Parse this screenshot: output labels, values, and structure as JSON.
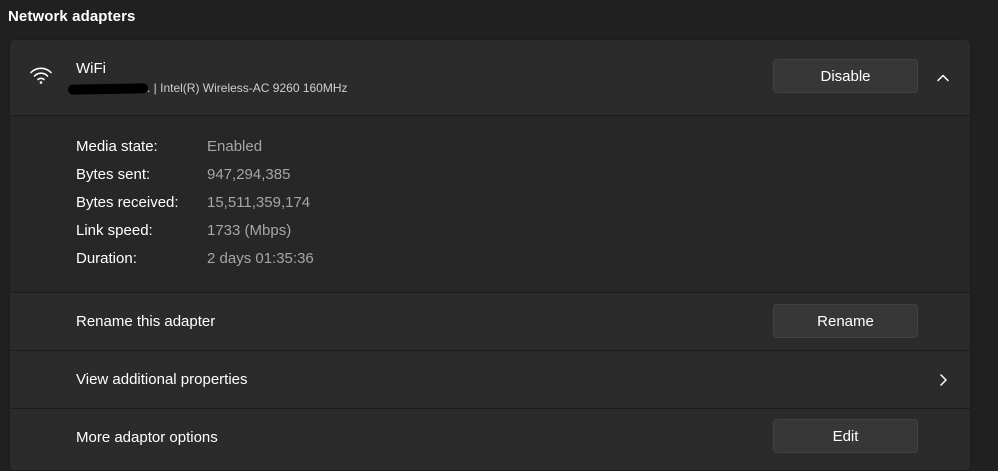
{
  "section": {
    "title": "Network adapters"
  },
  "adapter": {
    "name": "WiFi",
    "description": ". | Intel(R) Wireless-AC 9260 160MHz",
    "disable_label": "Disable",
    "expanded": true
  },
  "details": [
    {
      "label": "Media state:",
      "value": "Enabled"
    },
    {
      "label": "Bytes sent:",
      "value": "947,294,385"
    },
    {
      "label": "Bytes received:",
      "value": "15,511,359,174"
    },
    {
      "label": "Link speed:",
      "value": "1733 (Mbps)"
    },
    {
      "label": "Duration:",
      "value": "2 days 01:35:36"
    }
  ],
  "rename": {
    "label": "Rename this adapter",
    "button": "Rename"
  },
  "additional": {
    "label": "View additional properties"
  },
  "more_options": {
    "label": "More adaptor options",
    "button": "Edit"
  },
  "icons": {
    "adapter": "wifi-icon",
    "collapse": "chevron-up-icon",
    "navigate": "chevron-right-icon"
  }
}
